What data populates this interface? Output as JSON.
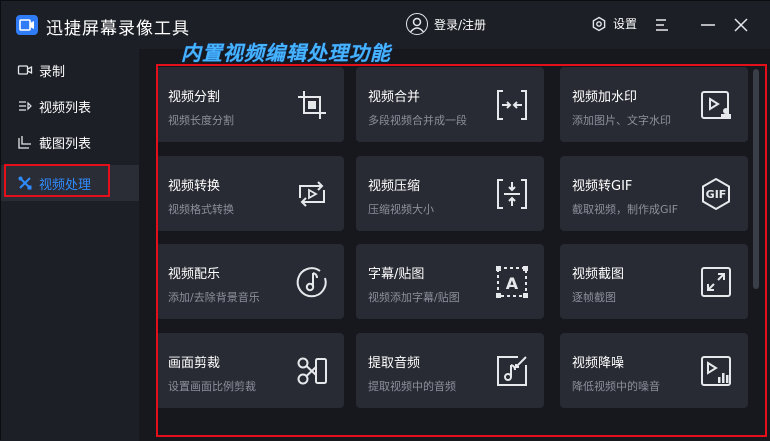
{
  "app": {
    "title": "迅捷屏幕录像工具"
  },
  "header": {
    "login_label": "登录/注册",
    "settings_label": "设置"
  },
  "sidebar": {
    "items": [
      {
        "label": "录制",
        "icon": "camera-icon"
      },
      {
        "label": "视频列表",
        "icon": "list-icon"
      },
      {
        "label": "截图列表",
        "icon": "screenshot-icon"
      },
      {
        "label": "视频处理",
        "icon": "tools-icon",
        "active": true
      }
    ]
  },
  "main": {
    "heading": "内置视频编辑处理功能",
    "cards": [
      {
        "title": "视频分割",
        "desc": "视频长度分割",
        "icon": "crop-icon"
      },
      {
        "title": "视频合并",
        "desc": "多段视频合并成一段",
        "icon": "merge-icon"
      },
      {
        "title": "视频加水印",
        "desc": "添加图片、文字水印",
        "icon": "watermark-icon"
      },
      {
        "title": "视频转换",
        "desc": "视频格式转换",
        "icon": "convert-icon"
      },
      {
        "title": "视频压缩",
        "desc": "压缩视频大小",
        "icon": "compress-icon"
      },
      {
        "title": "视频转GIF",
        "desc": "截取视频，制作成GIF",
        "icon": "gif-icon",
        "icon_text": "GIF"
      },
      {
        "title": "视频配乐",
        "desc": "添加/去除背景音乐",
        "icon": "music-icon"
      },
      {
        "title": "字幕/贴图",
        "desc": "视频添加字幕/贴图",
        "icon": "subtitle-icon",
        "icon_text": "A"
      },
      {
        "title": "视频截图",
        "desc": "逐帧截图",
        "icon": "expand-icon"
      },
      {
        "title": "画面剪裁",
        "desc": "设置画面比例剪裁",
        "icon": "scissors-icon"
      },
      {
        "title": "提取音频",
        "desc": "提取视频中的音频",
        "icon": "extract-audio-icon"
      },
      {
        "title": "视频降噪",
        "desc": "降低视频中的噪音",
        "icon": "denoise-icon"
      }
    ]
  },
  "colors": {
    "accent": "#2f8cff",
    "highlight_red": "#e3101c",
    "heading_blue": "#46b3ff",
    "card_bg": "#282b33"
  }
}
